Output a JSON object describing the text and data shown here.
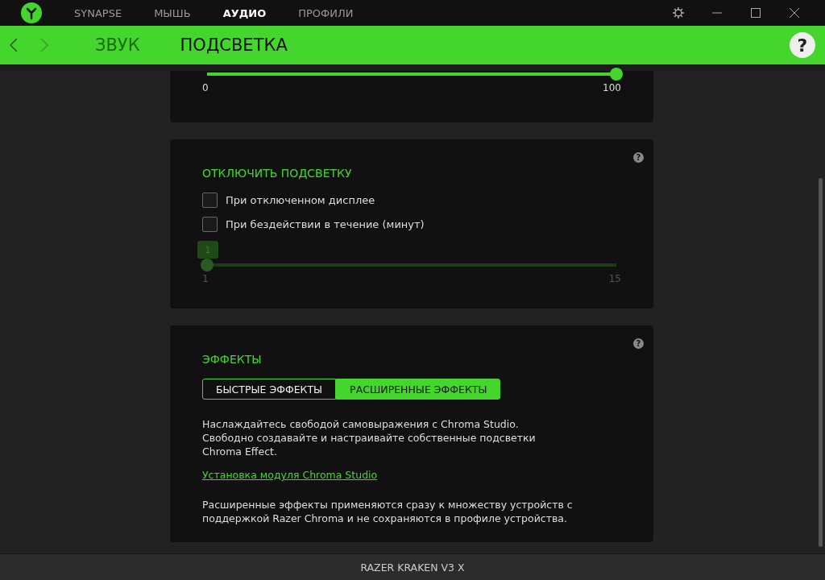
{
  "nav_tabs": [
    {
      "label": "SYNAPSE",
      "selected": false
    },
    {
      "label": "МЫШЬ",
      "selected": false
    },
    {
      "label": "АУДИО",
      "selected": true
    },
    {
      "label": "ПРОФИЛИ",
      "selected": false
    }
  ],
  "sub_tabs": [
    {
      "label": "ЗВУК",
      "selected": false
    },
    {
      "label": "ПОДСВЕТКА",
      "selected": true
    }
  ],
  "page_help": "?",
  "brightness": {
    "level": 1,
    "min": "0",
    "max": "100"
  },
  "disable_lighting": {
    "help": "?",
    "title": "ОТКЛЮЧИТЬ ПОДСВЕТКУ",
    "options": [
      {
        "label": "При отключенном дисплее",
        "checked": false
      },
      {
        "label": "При бездействии в течение (минут)",
        "checked": false
      }
    ],
    "slider": {
      "level": 0,
      "disabled": true,
      "value": "1",
      "min": "1",
      "max": "15"
    }
  },
  "effects": {
    "help": "?",
    "title": "ЭФФЕКТЫ",
    "segments": [
      {
        "label": "БЫСТРЫЕ ЭФФЕКТЫ",
        "selected": false
      },
      {
        "label": "РАСШИРЕННЫЕ ЭФФЕКТЫ",
        "selected": true
      }
    ],
    "description": "Наслаждайтесь свободой самовыражения с Chroma Studio. Свободно создавайте и настраивайте собственные подсветки Chroma Effect.",
    "link": "Установка модуля Chroma Studio",
    "note": "Расширенные эффекты применяются сразу к множеству устройств с поддержкой Razer Chroma и не сохраняются в профиле устройства."
  },
  "status_bar": {
    "device": "RAZER KRAKEN V3 X"
  }
}
